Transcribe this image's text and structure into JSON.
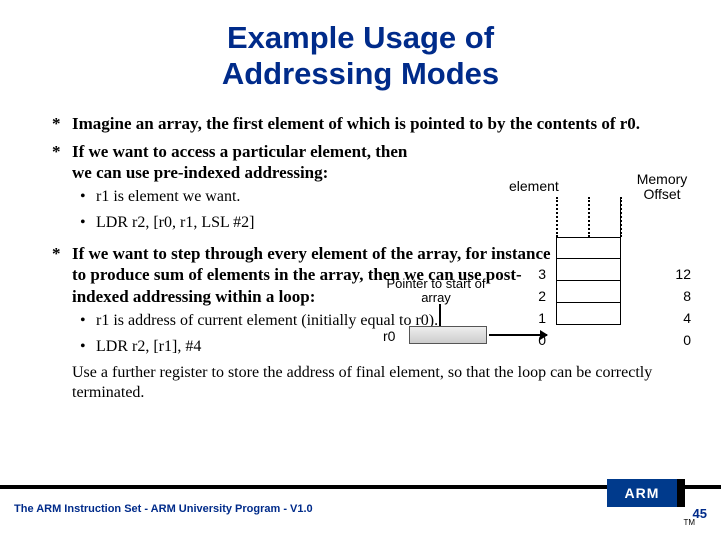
{
  "title_line1": "Example Usage of",
  "title_line2": "Addressing Modes",
  "bullets": {
    "b1": "Imagine an array, the first element of which is pointed to by the contents of r0.",
    "b2": "If we want to access a particular element, then we can use pre-indexed addressing:",
    "b2_sub1": "r1 is element we want.",
    "b2_sub2": "LDR r2, [r0, r1, LSL #2]",
    "b3": "If we want to step through every element of the array, for instance to produce sum of elements in the array, then we can use post-indexed addressing within a loop:",
    "b3_sub1": "r1 is address of current element (initially equal to r0).",
    "b3_sub2": "LDR r2, [r1], #4",
    "b3_after": "Use a further register to store the address of final element, so that the loop can be correctly terminated."
  },
  "diagram": {
    "element_label": "element",
    "memory_label": "Memory Offset",
    "pointer_label": "Pointer to start of array",
    "r0": "r0",
    "indices": [
      "3",
      "2",
      "1",
      "0"
    ],
    "offsets": [
      "12",
      "8",
      "4",
      "0"
    ]
  },
  "footer": "The ARM Instruction Set - ARM University Program - V1.0",
  "page": "45",
  "logo": "ARM",
  "tm": "TM"
}
